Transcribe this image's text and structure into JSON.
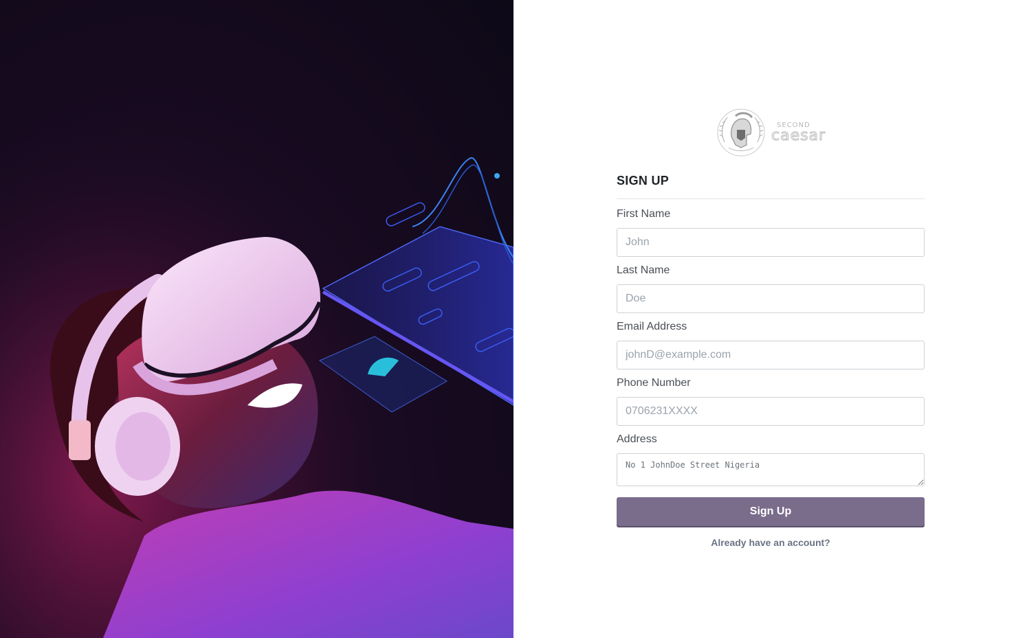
{
  "hero": {
    "image": "vr-headset-man-with-headphones",
    "colors": {
      "background": "#0d0917",
      "accent_pink": "#e0418a",
      "accent_blue": "#3a4dff",
      "headset": "#f1d6f0"
    }
  },
  "brand": {
    "logo": "spartan-helmet-laurel-logo"
  },
  "form": {
    "title": "SIGN UP",
    "fields": [
      {
        "label": "First Name",
        "placeholder": "John",
        "value": ""
      },
      {
        "label": "Last Name",
        "placeholder": "Doe",
        "value": ""
      },
      {
        "label": "Email Address",
        "placeholder": "johnD@example.com",
        "value": ""
      },
      {
        "label": "Phone Number",
        "placeholder": "0706231XXXX",
        "value": ""
      }
    ],
    "address": {
      "label": "Address",
      "placeholder": "No 1 JohnDoe Street Nigeria",
      "value": ""
    },
    "submit_label": "Sign Up",
    "signin_link": "Already have an account?"
  },
  "colors": {
    "button": "#7a6c8b",
    "link": "#6a7384"
  }
}
